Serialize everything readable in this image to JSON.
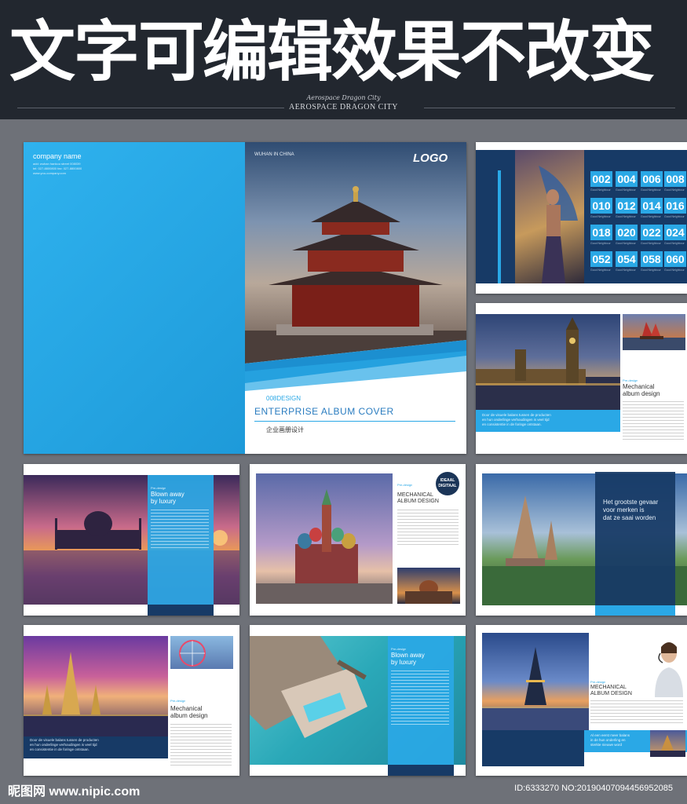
{
  "header": {
    "title": "文字可编辑效果不改变",
    "script_line": "Aerospace Dragon City",
    "caps_line": "AEROSPACE DRAGON CITY"
  },
  "cover": {
    "company_name": "company name",
    "address": "add: wuhan hankou street 008039",
    "tel": "tel: 027-8800800 fax: 027-8800800",
    "web": "www.you-company.com",
    "city": "WUHAN IN CHINA",
    "logo": "LOGO",
    "design_code": "008DESIGN",
    "cover_title": "ENTERPRISE ALBUM COVER",
    "cn_subtitle": "企业画册设计"
  },
  "catalog": {
    "numbers": [
      "002",
      "004",
      "006",
      "008",
      "010",
      "012",
      "014",
      "016",
      "018",
      "020",
      "022",
      "024",
      "052",
      "054",
      "058",
      "060"
    ],
    "item_label": "Good Neighbour"
  },
  "spreads": {
    "mechanical_lower": "Mechanical",
    "album_design_lower": "album design",
    "mechanical_upper": "MECHANICAL",
    "album_design_upper": "ALBUM DESIGN",
    "blown_away": "Blown away",
    "by_luxury": "by luxury",
    "dutch_l1": "Door de visuele balans tussen de producten",
    "dutch_l2": "en hun onderlinge verhoudingen is veel tijd",
    "dutch_l3": "en consistentie in de foringe ontstaan.",
    "dutch_short_l1": "Al een eerst meer balans",
    "dutch_short_l2": "in de hun onderling en",
    "dutch_short_l3": "sterkte nieuwe word",
    "badge_l1": "IDEAAL",
    "badge_l2": "DIGITAAL",
    "risk_l1": "Het grootste gevaar",
    "risk_l2": "voor merken is",
    "risk_l3": "dat ze saai worden",
    "small_label": "Pre-design"
  },
  "footer": {
    "watermark": "昵图网 www.nipic.com",
    "id_text": "ID:6333270 NO:20190407094456952085"
  },
  "colors": {
    "accent": "#2aa8e6",
    "navy": "#173a66",
    "header_bg": "#22272f",
    "canvas": "#6e7178"
  }
}
